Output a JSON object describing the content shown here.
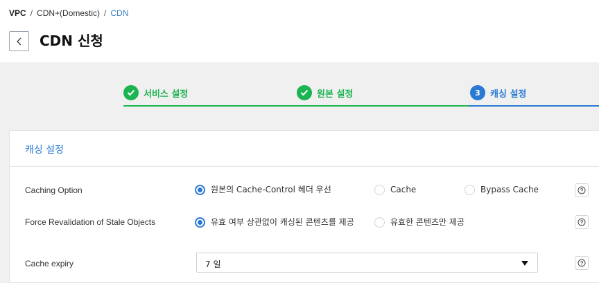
{
  "breadcrumb": {
    "items": [
      "VPC",
      "CDN+(Domestic)",
      "CDN"
    ],
    "separator": "/"
  },
  "header": {
    "back_icon": "chevron-left-icon",
    "title": "CDN 신청"
  },
  "steps": [
    {
      "label": "서비스 설정",
      "status": "done",
      "icon": "check-icon"
    },
    {
      "label": "원본 설정",
      "status": "done",
      "icon": "check-icon"
    },
    {
      "label": "캐싱 설정",
      "status": "active",
      "number": "3"
    }
  ],
  "colors": {
    "done": "#1cb451",
    "active": "#2a7ad3",
    "background": "#f0f0f0"
  },
  "card": {
    "title": "캐싱 설정",
    "caching_option": {
      "label": "Caching Option",
      "options": [
        "원본의 Cache-Control 헤더 우선",
        "Cache",
        "Bypass Cache"
      ],
      "selected": "원본의 Cache-Control 헤더 우선"
    },
    "force_revalidation": {
      "label": "Force Revalidation of Stale Objects",
      "options": [
        "유효 여부 상관없이 캐싱된 콘텐츠를 제공",
        "유효한 콘텐츠만 제공"
      ],
      "selected": "유효 여부 상관없이 캐싱된 콘텐츠를 제공"
    },
    "cache_expiry": {
      "label": "Cache expiry",
      "value": "7 일"
    },
    "help_icon": "question-circle-icon"
  }
}
